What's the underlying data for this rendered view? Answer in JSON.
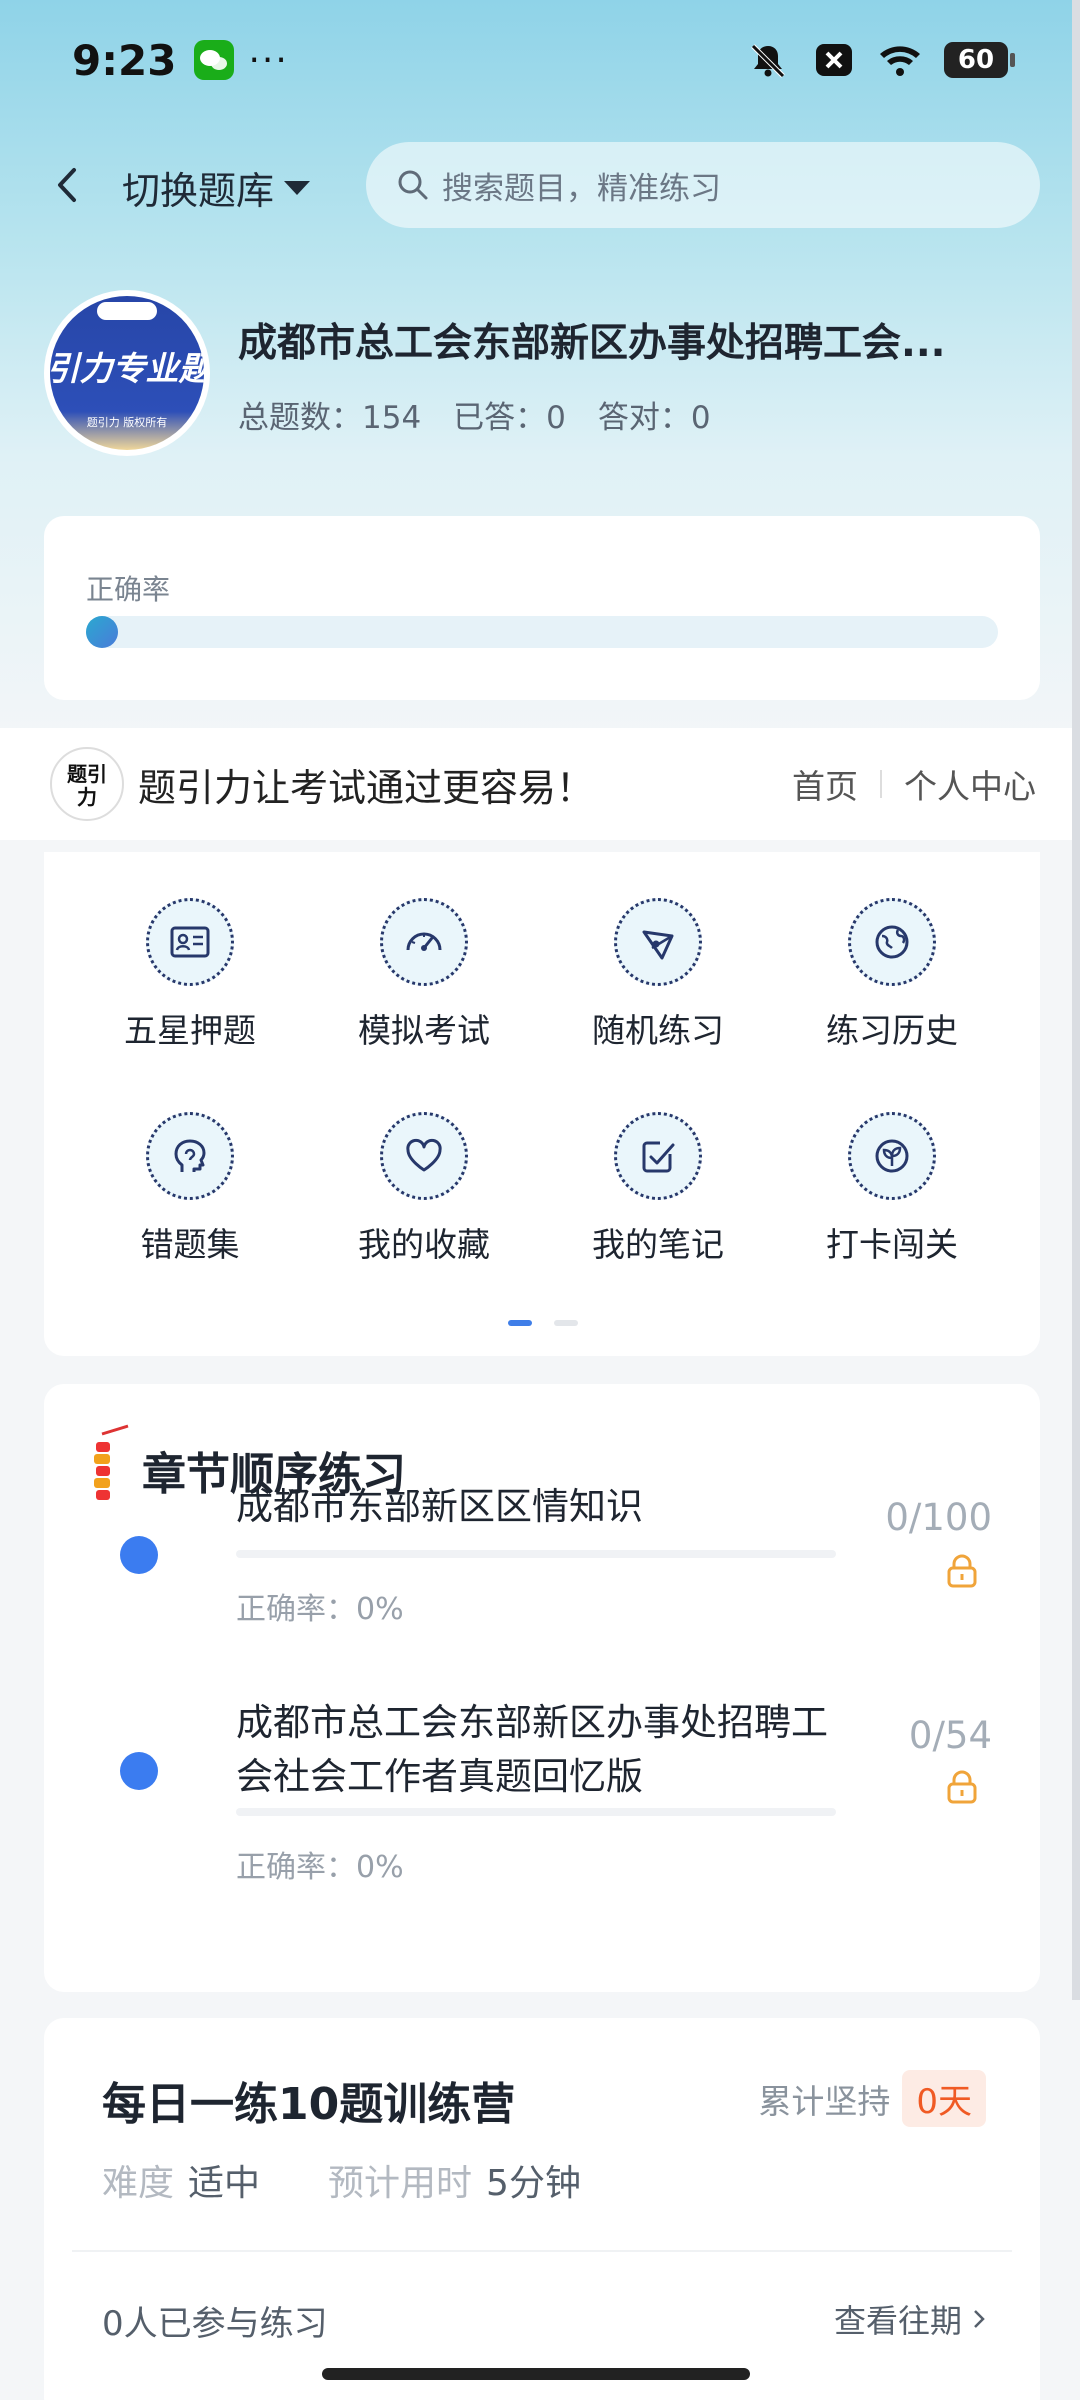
{
  "status_bar": {
    "time": "9:23",
    "dots": "···",
    "battery": "60"
  },
  "nav": {
    "switch_label": "切换题库",
    "search_placeholder": "搜索题目，精准练习"
  },
  "bank": {
    "logo_main": "引力专业题",
    "logo_sub": "题引力 版权所有",
    "title": "成都市总工会东部新区办事处招聘工会...",
    "total": "总题数：154",
    "answered": "已答：0",
    "correct": "答对：0"
  },
  "accuracy": {
    "label": "正确率",
    "value": 0
  },
  "slogan": {
    "logo_text": "题引力",
    "text": "题引力让考试通过更容易！",
    "home": "首页",
    "profile": "个人中心"
  },
  "grid": {
    "items": [
      {
        "label": "五星押题",
        "icon": "id-card-icon"
      },
      {
        "label": "模拟考试",
        "icon": "speedometer-icon"
      },
      {
        "label": "随机练习",
        "icon": "network-icon"
      },
      {
        "label": "练习历史",
        "icon": "globe-icon"
      },
      {
        "label": "错题集",
        "icon": "head-icon"
      },
      {
        "label": "我的收藏",
        "icon": "heart-icon"
      },
      {
        "label": "我的笔记",
        "icon": "note-check-icon"
      },
      {
        "label": "打卡闯关",
        "icon": "sprout-icon"
      }
    ],
    "page": 1,
    "pages": 2
  },
  "chapters": {
    "title": "章节顺序练习",
    "items": [
      {
        "name": "成都市东部新区区情知识",
        "count": "0/100",
        "accuracy": "正确率：0%"
      },
      {
        "name": "成都市总工会东部新区办事处招聘工会社会工作者真题回忆版",
        "count": "0/54",
        "accuracy": "正确率：0%"
      }
    ]
  },
  "camp": {
    "title": "每日一练10题训练营",
    "persist_label": "累计坚持",
    "persist_days": "0天",
    "difficulty_label": "难度",
    "difficulty_value": "适中",
    "time_label": "预计用时",
    "time_value": "5分钟",
    "participants": "0人已参与练习",
    "history": "查看往期"
  },
  "colors": {
    "accent": "#3b7cf0",
    "streak": "#f05a24",
    "lock": "#f0a43a",
    "icon_stroke": "#27386b"
  }
}
